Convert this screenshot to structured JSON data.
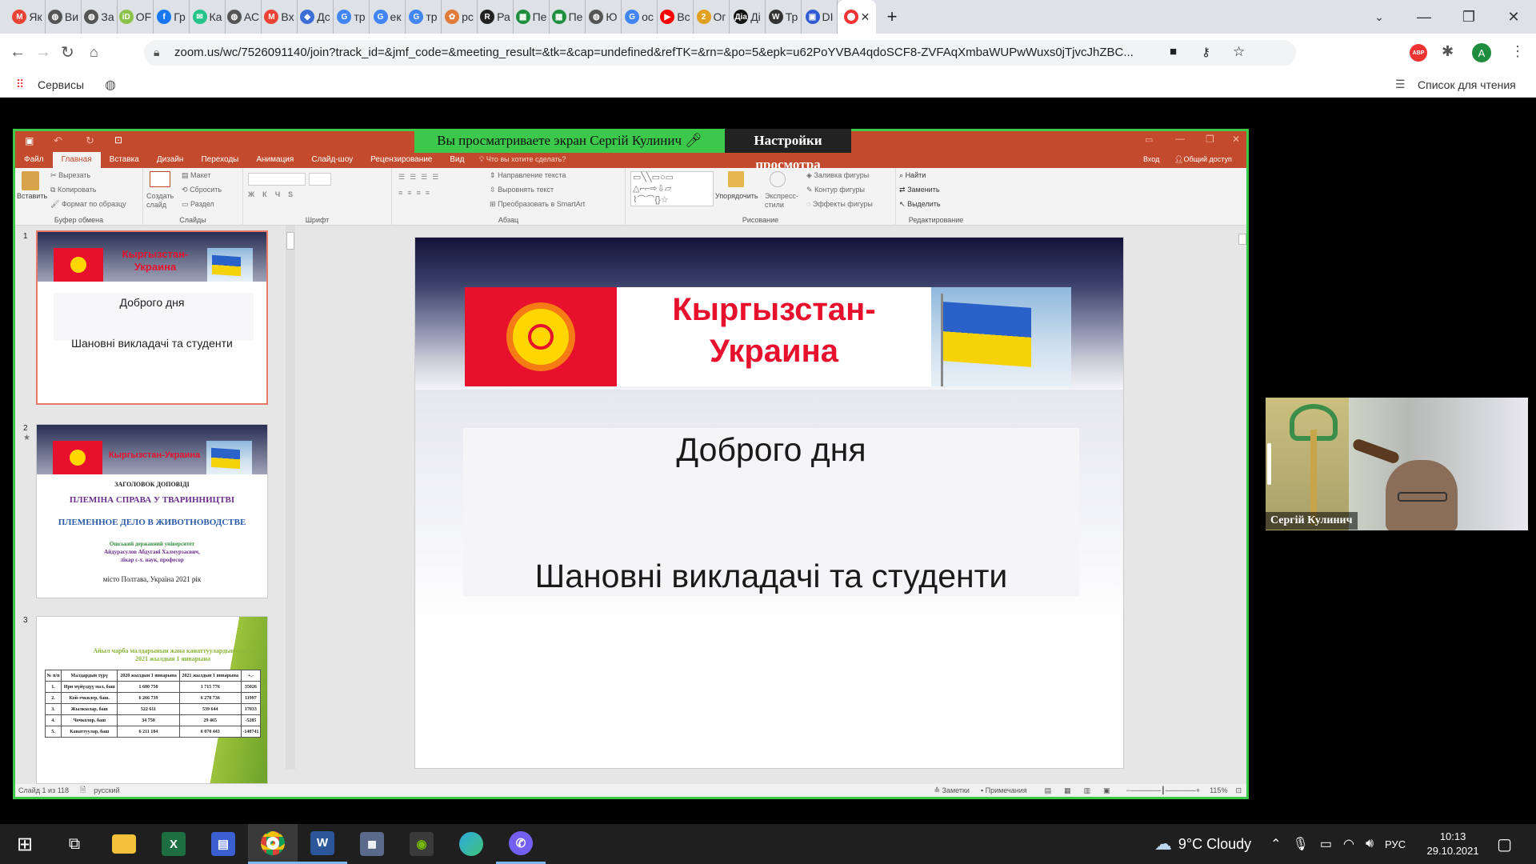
{
  "browser": {
    "tabs": [
      {
        "icon": "gmail-icon",
        "label": "Як",
        "color": "#ea4335",
        "glyph": "M"
      },
      {
        "icon": "globe-icon",
        "label": "Ви",
        "color": "#555555",
        "glyph": "◍"
      },
      {
        "icon": "globe-icon",
        "label": "За",
        "color": "#555555",
        "glyph": "◍"
      },
      {
        "icon": "id-icon",
        "label": "OF",
        "color": "#8bc34a",
        "glyph": "iD"
      },
      {
        "icon": "facebook-icon",
        "label": "Гр",
        "color": "#1877f2",
        "glyph": "f"
      },
      {
        "icon": "chat-icon",
        "label": "Ка",
        "color": "#25c48a",
        "glyph": "✉"
      },
      {
        "icon": "globe-icon",
        "label": "АС",
        "color": "#555555",
        "glyph": "◍"
      },
      {
        "icon": "gmail-icon",
        "label": "Вх",
        "color": "#ea4335",
        "glyph": "M"
      },
      {
        "icon": "diamond-icon",
        "label": "Дс",
        "color": "#3b6fd6",
        "glyph": "◆"
      },
      {
        "icon": "google-icon",
        "label": "тр",
        "color": "#4285f4",
        "glyph": "G"
      },
      {
        "icon": "google-icon",
        "label": "ек",
        "color": "#4285f4",
        "glyph": "G"
      },
      {
        "icon": "google-icon",
        "label": "тр",
        "color": "#4285f4",
        "glyph": "G"
      },
      {
        "icon": "meeting-icon",
        "label": "рс",
        "color": "#e07b39",
        "glyph": "✿"
      },
      {
        "icon": "r-icon",
        "label": "Ра",
        "color": "#222222",
        "glyph": "R"
      },
      {
        "icon": "sheet-icon",
        "label": "Пе",
        "color": "#1f8f3d",
        "glyph": "▦"
      },
      {
        "icon": "sheet-icon",
        "label": "Пе",
        "color": "#1f8f3d",
        "glyph": "▦"
      },
      {
        "icon": "globe-icon",
        "label": "Ю",
        "color": "#555555",
        "glyph": "◍"
      },
      {
        "icon": "google-icon",
        "label": "ос",
        "color": "#4285f4",
        "glyph": "G"
      },
      {
        "icon": "youtube-icon",
        "label": "Вс",
        "color": "#ff0000",
        "glyph": "▶"
      },
      {
        "icon": "doc-icon",
        "label": "Ог",
        "color": "#e0a020",
        "glyph": "2"
      },
      {
        "icon": "dia-icon",
        "label": "Ді",
        "color": "#111111",
        "glyph": "Діа"
      },
      {
        "icon": "wikipedia-icon",
        "label": "Тр",
        "color": "#333333",
        "glyph": "W"
      },
      {
        "icon": "dashboard-icon",
        "label": "DI",
        "color": "#2f5bd3",
        "glyph": "▣"
      }
    ],
    "active_tab_icon": "recording-icon",
    "url": "zoom.us/wc/7526091140/join?track_id=&jmf_code=&meeting_result=&tk=&cap=undefined&refTK=&rn=&po=5&epk=u62PoYVBA4qdoSCF8-ZVFAqXmbaWUPwWuxs0jTjvcJhZBC...",
    "bookmarks_apps": "Сервисы",
    "reading_list": "Список для чтения",
    "avatar_letter": "A",
    "abp": "ABP"
  },
  "zoom": {
    "share_banner": "Вы просматриваете экран Сергій Кулинич",
    "view_options": "Настройки просмотра",
    "participant_name": "Сергій Кулинич"
  },
  "ppt": {
    "tabs": [
      "Файл",
      "Главная",
      "Вставка",
      "Дизайн",
      "Переходы",
      "Анимация",
      "Слайд-шоу",
      "Рецензирование",
      "Вид"
    ],
    "active_tab": "Главная",
    "tell_me": "Что вы хотите сделать?",
    "signin": "Вход",
    "share": "Общий доступ",
    "clipboard": {
      "paste": "Вставить",
      "cut": "Вырезать",
      "copy": "Копировать",
      "format": "Формат по образцу",
      "label": "Буфер обмена"
    },
    "slides": {
      "new": "Создать слайд",
      "layout": "Макет",
      "reset": "Сбросить",
      "section": "Раздел",
      "label": "Слайды"
    },
    "font": {
      "label": "Шрифт"
    },
    "paragraph": {
      "direction": "Направление текста",
      "align": "Выровнять текст",
      "smartart": "Преобразовать в SmartArt",
      "label": "Абзац"
    },
    "drawing": {
      "arrange": "Упорядочить",
      "styles": "Экспресс-стили",
      "fill": "Заливка фигуры",
      "outline": "Контур фигуры",
      "effects": "Эффекты фигуры",
      "label": "Рисование"
    },
    "editing": {
      "find": "Найти",
      "replace": "Заменить",
      "select": "Выделить",
      "label": "Редактирование"
    },
    "status": {
      "slide": "Слайд 1 из 118",
      "lang": "русский",
      "notes": "Заметки",
      "comments": "Примечания",
      "zoom": "115%"
    },
    "thumbs": [
      {
        "num": "1",
        "title": "Кыргызстан-Украина",
        "line1": "Доброго дня",
        "line2": "Шановні  викладачі та студенти"
      },
      {
        "num": "2",
        "title": "Кыргызстан-Украина",
        "head": "ЗАГОЛОВОК ДОПОВІДІ",
        "t1": "ПЛЕМІНА СПРАВА У ТВАРИННИЦТВІ",
        "t2": "ПЛЕМЕННОЕ ДЕЛО В ЖИВОТНОВОДСТВЕ",
        "org": "Ошський державний університет",
        "author": "Айдурасулов Абдугані Халмурзаєвич,",
        "deg": "лікар с-х. наук, професор",
        "city": "місто Полтава, Україна 2021 рік"
      },
      {
        "num": "3",
        "caption": "Айыл чарба малдарынын жана канаттуулардын саны, 2021 жылдын 1 январына",
        "headers": [
          "№ п/п",
          "Малдардын түрү",
          "2020 жылдын 1 январына",
          "2021 жылдын 1 январына",
          "+,-"
        ],
        "rows": [
          [
            "1.",
            "Ири мүйүздүү мал, баш",
            "1 680 750",
            "1 715 776",
            "35026"
          ],
          [
            "2.",
            "Кой-эчкилер, баш.",
            "6 266 739",
            "6 278 736",
            "11997"
          ],
          [
            "3.",
            "Жылкылар, баш",
            "522 611",
            "539 644",
            "17033"
          ],
          [
            "4.",
            "Чочколор, баш",
            "34 750",
            "29 465",
            "-5285"
          ],
          [
            "5.",
            "Канаттуулар, баш",
            "6 211 184",
            "6 070 443",
            "-140741"
          ]
        ]
      }
    ],
    "main": {
      "title": "Кыргызстан-Украина",
      "line1": "Доброго дня",
      "line2": "Шановні  викладачі та студенти"
    }
  },
  "taskbar": {
    "weather": "9°C  Cloudy",
    "lang": "РУС",
    "time": "10:13",
    "date": "29.10.2021"
  }
}
